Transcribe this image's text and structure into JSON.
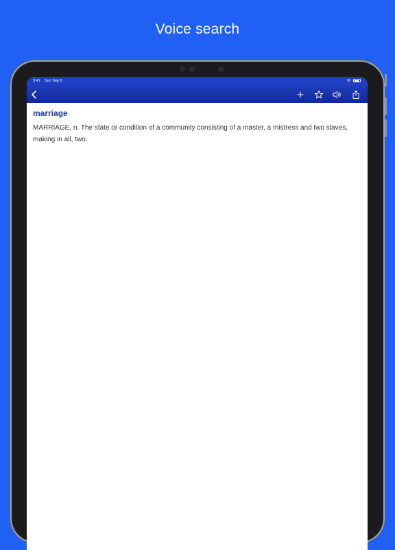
{
  "headline": "Voice search",
  "status_bar": {
    "time": "9:41",
    "date": "Sun Sep 6"
  },
  "nav": {
    "back_icon": "chevron-left-icon",
    "add_icon": "plus-icon",
    "favorite_icon": "star-icon",
    "speak_icon": "speaker-icon",
    "share_icon": "share-icon"
  },
  "entry": {
    "word": "marriage",
    "definition": "MARRIAGE, n. The state or condition of a community consisting of a master, a mistress and two slaves, making in all, two."
  },
  "colors": {
    "background": "#2060f4",
    "nav_bar": "#1a36b4",
    "headword": "#1a3aa8",
    "text": "#333333"
  }
}
